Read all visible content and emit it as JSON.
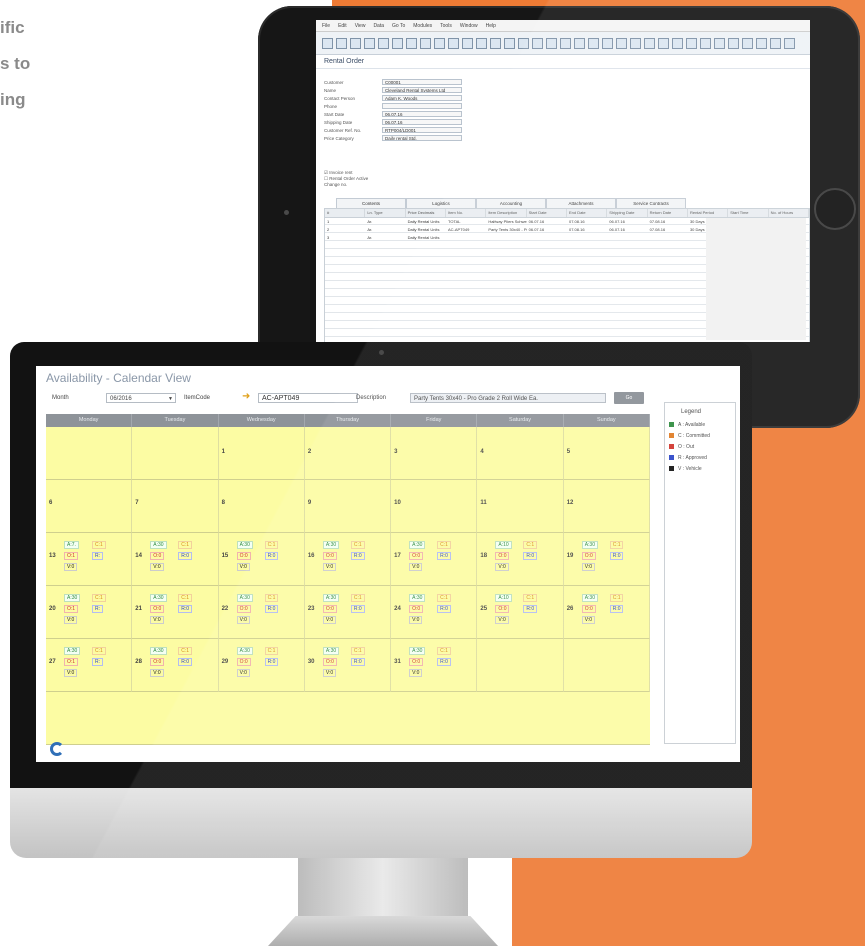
{
  "marketing": {
    "lines": [
      "ific",
      "s to",
      "ing"
    ]
  },
  "tablet": {
    "menu": [
      "File",
      "Edit",
      "View",
      "Data",
      "Go To",
      "Modules",
      "Tools",
      "Window",
      "Help"
    ],
    "form_title": "Rental Order",
    "fields": [
      {
        "label": "Customer",
        "value": "C00001"
      },
      {
        "label": "Name",
        "value": "Cleveland Rental Systems Ltd"
      },
      {
        "label": "Contact Person",
        "value": "Adam K. Woods"
      },
      {
        "label": "Phone",
        "value": ""
      },
      {
        "label": "Start Date",
        "value": "06.07.16"
      },
      {
        "label": "Shipping Date",
        "value": "06.07.16"
      },
      {
        "label": "Customer Ref. No.",
        "value": "RTP004/LD001"
      },
      {
        "label": "Price Category",
        "value": "Daily rental Std."
      }
    ],
    "checks": [
      "Invoice rent",
      "Rental Order Active",
      "Change no."
    ],
    "tabs": [
      "Contents",
      "Logistics",
      "Accounting",
      "Attachments",
      "Service Contracts"
    ],
    "grid_headers": [
      "#",
      "Ln. Type",
      "Price Decimals",
      "Item No.",
      "Item Description",
      "Start Date",
      "End Date",
      "Shipping Date",
      "Return Date",
      "Rental Period",
      "Start Time",
      "No. of Hours"
    ],
    "grid_rows": [
      [
        "1",
        "Ar.",
        "Daily Rental Units",
        "TOTAL",
        "Halfway Pliers Schweighofer Plug",
        "06.07.16",
        "07.08.16",
        "06.07.16",
        "07.08.16",
        "30 Days",
        "",
        ""
      ],
      [
        "2",
        "Ar.",
        "Daily Rental Units",
        "AC-APT049",
        "Party Tents 30x40 - Pro Grade",
        "06.07.16",
        "07.08.16",
        "06.07.16",
        "07.08.16",
        "30 Days",
        "",
        ""
      ],
      [
        "3",
        "Ar.",
        "Daily Rental Units",
        "",
        "",
        "",
        "",
        "",
        "",
        "",
        "",
        ""
      ]
    ]
  },
  "calendar": {
    "title": "Availability - Calendar View",
    "month_label": "Month",
    "month_value": "06/2016",
    "item_label": "ItemCode",
    "item_value": "AC-APT049",
    "desc_label": "Description",
    "desc_value": "Party Tents 30x40 - Pro Grade 2 Roll Wide Ea.",
    "go_label": "Go",
    "weekdays": [
      "Monday",
      "Tuesday",
      "Wednesday",
      "Thursday",
      "Friday",
      "Saturday",
      "Sunday"
    ],
    "weeks": [
      [
        {
          "day": ""
        },
        {
          "day": ""
        },
        {
          "day": "1"
        },
        {
          "day": "2"
        },
        {
          "day": "3"
        },
        {
          "day": "4"
        },
        {
          "day": "5"
        }
      ],
      [
        {
          "day": "6"
        },
        {
          "day": "7"
        },
        {
          "day": "8"
        },
        {
          "day": "9"
        },
        {
          "day": "10"
        },
        {
          "day": "11"
        },
        {
          "day": "12"
        }
      ],
      [
        {
          "day": "13",
          "a": "A:7.",
          "c": "C:1",
          "o": "O:1",
          "r": "R:",
          "v": "V:0"
        },
        {
          "day": "14",
          "a": "A:30",
          "c": "C:1",
          "o": "O:0",
          "r": "R:0",
          "v": "V:0"
        },
        {
          "day": "15",
          "a": "A:30",
          "c": "C:1",
          "o": "O:0",
          "r": "R:0",
          "v": "V:0"
        },
        {
          "day": "16",
          "a": "A:30",
          "c": "C:1",
          "o": "O:0",
          "r": "R:0",
          "v": "V:0"
        },
        {
          "day": "17",
          "a": "A:30",
          "c": "C:1",
          "o": "O:0",
          "r": "R:0",
          "v": "V:0"
        },
        {
          "day": "18",
          "a": "A:10",
          "c": "C:1",
          "o": "O:0",
          "r": "R:0",
          "v": "V:0"
        },
        {
          "day": "19",
          "a": "A:30",
          "c": "C:1",
          "o": "O:0",
          "r": "R:0",
          "v": "V:0"
        }
      ],
      [
        {
          "day": "20",
          "a": "A:30",
          "c": "C:1",
          "o": "O:1",
          "r": "R:",
          "v": "V:0"
        },
        {
          "day": "21",
          "a": "A:30",
          "c": "C:1",
          "o": "O:0",
          "r": "R:0",
          "v": "V:0"
        },
        {
          "day": "22",
          "a": "A:30",
          "c": "C:1",
          "o": "O:0",
          "r": "R:0",
          "v": "V:0"
        },
        {
          "day": "23",
          "a": "A:30",
          "c": "C:1",
          "o": "O:0",
          "r": "R:0",
          "v": "V:0"
        },
        {
          "day": "24",
          "a": "A:30",
          "c": "C:1",
          "o": "O:0",
          "r": "R:0",
          "v": "V:0"
        },
        {
          "day": "25",
          "a": "A:10",
          "c": "C:1",
          "o": "O:0",
          "r": "R:0",
          "v": "V:0"
        },
        {
          "day": "26",
          "a": "A:30",
          "c": "C:1",
          "o": "O:0",
          "r": "R:0",
          "v": "V:0"
        }
      ],
      [
        {
          "day": "27",
          "a": "A:30",
          "c": "C:1",
          "o": "O:1",
          "r": "R:",
          "v": "V:0"
        },
        {
          "day": "28",
          "a": "A:30",
          "c": "C:1",
          "o": "O:0",
          "r": "R:0",
          "v": "V:0"
        },
        {
          "day": "29",
          "a": "A:30",
          "c": "C:1",
          "o": "O:0",
          "r": "R:0",
          "v": "V:0"
        },
        {
          "day": "30",
          "a": "A:30",
          "c": "C:1",
          "o": "O:0",
          "r": "R:0",
          "v": "V:0"
        },
        {
          "day": "31",
          "a": "A:30",
          "c": "C:1",
          "o": "O:0",
          "r": "R:0",
          "v": "V:0"
        },
        {
          "day": ""
        },
        {
          "day": ""
        }
      ]
    ],
    "legend_title": "Legend",
    "legend": [
      {
        "label": "A : Available",
        "color": "#2e8b3e"
      },
      {
        "label": "C : Committed",
        "color": "#e07b22"
      },
      {
        "label": "O : Out",
        "color": "#d0342c"
      },
      {
        "label": "R : Approved",
        "color": "#2b45c8"
      },
      {
        "label": "V : Vehicle",
        "color": "#111111"
      }
    ]
  },
  "colors": {
    "brand_orange": "#ee7b35",
    "calendar_bg": "#fcfca3",
    "header_gray": "#8e9399"
  }
}
